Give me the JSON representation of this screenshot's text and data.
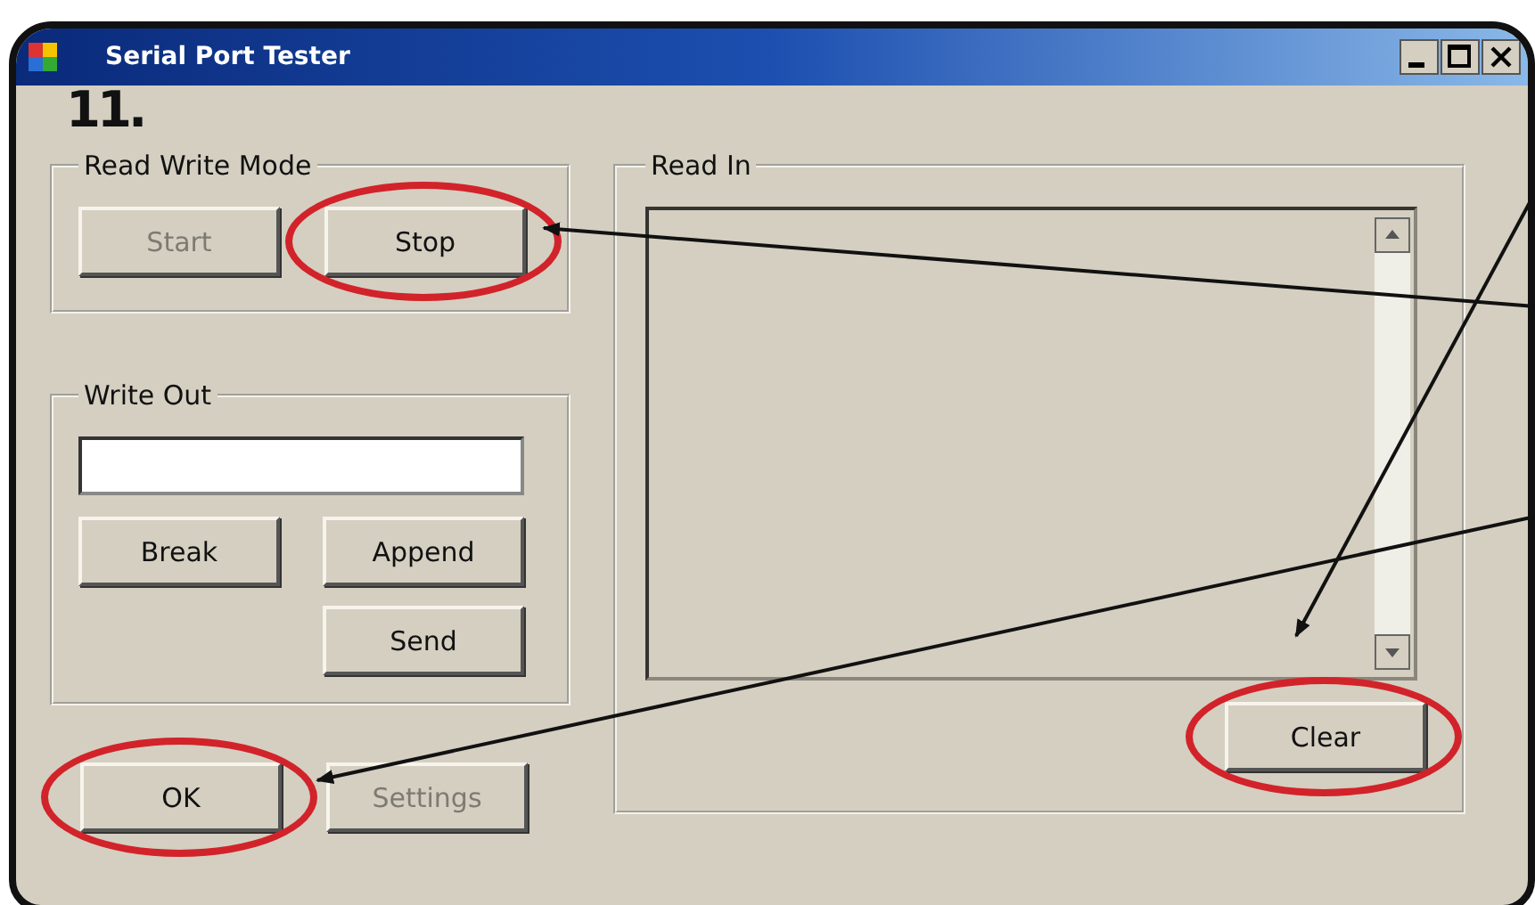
{
  "window": {
    "title": "Serial Port Tester"
  },
  "step_label": "11.",
  "read_write_mode": {
    "title": "Read Write Mode",
    "buttons": [
      {
        "label": "Start",
        "disabled": true,
        "circled": false
      },
      {
        "label": "Stop",
        "disabled": false,
        "circled": true
      }
    ]
  },
  "write_out": {
    "title": "Write Out",
    "buttons": [
      {
        "label": "Break",
        "disabled": false,
        "circled": false
      },
      {
        "label": "Append",
        "disabled": false,
        "circled": false
      },
      {
        "label": "Send",
        "disabled": false,
        "circled": false
      }
    ]
  },
  "footer_buttons": [
    {
      "label": "OK",
      "disabled": false,
      "circled": true
    },
    {
      "label": "Settings",
      "disabled": true,
      "circled": false
    }
  ],
  "read_in": {
    "title": "Read In",
    "clear_button": {
      "label": "Clear",
      "disabled": false,
      "circled": true
    }
  }
}
